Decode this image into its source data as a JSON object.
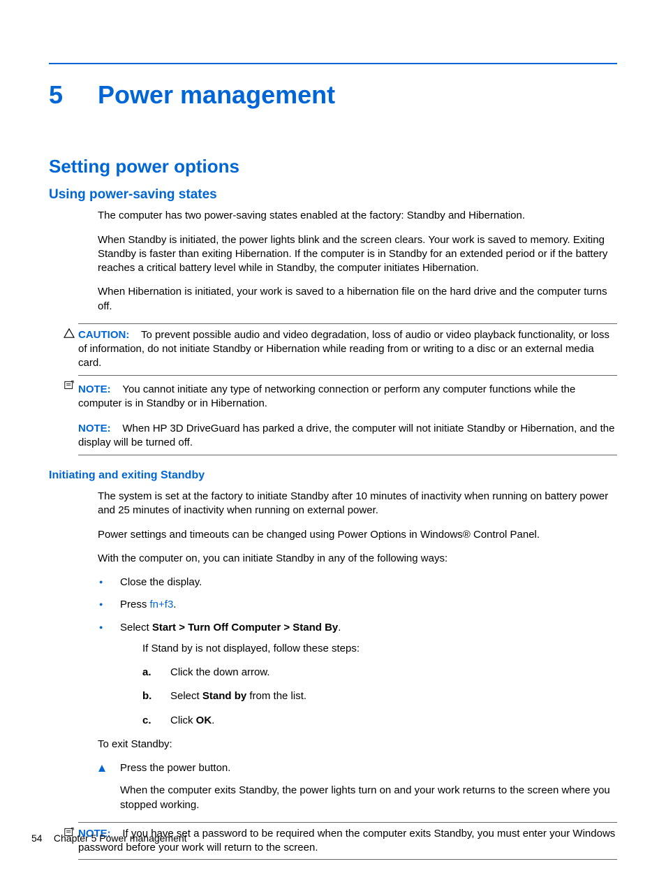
{
  "chapter": {
    "number": "5",
    "title": "Power management"
  },
  "h2": "Setting power options",
  "h3": "Using power-saving states",
  "p1": "The computer has two power-saving states enabled at the factory: Standby and Hibernation.",
  "p2": "When Standby is initiated, the power lights blink and the screen clears. Your work is saved to memory. Exiting Standby is faster than exiting Hibernation. If the computer is in Standby for an extended period or if the battery reaches a critical battery level while in Standby, the computer initiates Hibernation.",
  "p3": "When Hibernation is initiated, your work is saved to a hibernation file on the hard drive and the computer turns off.",
  "caution": {
    "label": "CAUTION:",
    "text": "To prevent possible audio and video degradation, loss of audio or video playback functionality, or loss of information, do not initiate Standby or Hibernation while reading from or writing to a disc or an external media card."
  },
  "note1": {
    "label": "NOTE:",
    "text": "You cannot initiate any type of networking connection or perform any computer functions while the computer is in Standby or in Hibernation."
  },
  "note2": {
    "label": "NOTE:",
    "text": "When HP 3D DriveGuard has parked a drive, the computer will not initiate Standby or Hibernation, and the display will be turned off."
  },
  "h4": "Initiating and exiting Standby",
  "p4": "The system is set at the factory to initiate Standby after 10 minutes of inactivity when running on battery power and 25 minutes of inactivity when running on external power.",
  "p5": "Power settings and timeouts can be changed using Power Options in Windows® Control Panel.",
  "p6": "With the computer on, you can initiate Standby in any of the following ways:",
  "bullets": {
    "b1": "Close the display.",
    "b2a": "Press ",
    "b2b": "fn+f3",
    "b2c": ".",
    "b3a": "Select ",
    "b3b": "Start > Turn Off Computer > Stand By",
    "b3c": "."
  },
  "sub_intro": "If Stand by is not displayed, follow these steps:",
  "letters": {
    "a": "a.",
    "at": "Click the down arrow.",
    "b": "b.",
    "bt_pre": "Select ",
    "bt_bold": "Stand by",
    "bt_post": " from the list.",
    "c": "c.",
    "ct_pre": "Click ",
    "ct_bold": "OK",
    "ct_post": "."
  },
  "p7": "To exit Standby:",
  "tri1": "Press the power button.",
  "tri_sub": "When the computer exits Standby, the power lights turn on and your work returns to the screen where you stopped working.",
  "note3": {
    "label": "NOTE:",
    "text": "If you have set a password to be required when the computer exits Standby, you must enter your Windows password before your work will return to the screen."
  },
  "footer": {
    "page": "54",
    "chapter_ref": "Chapter 5   Power management"
  }
}
